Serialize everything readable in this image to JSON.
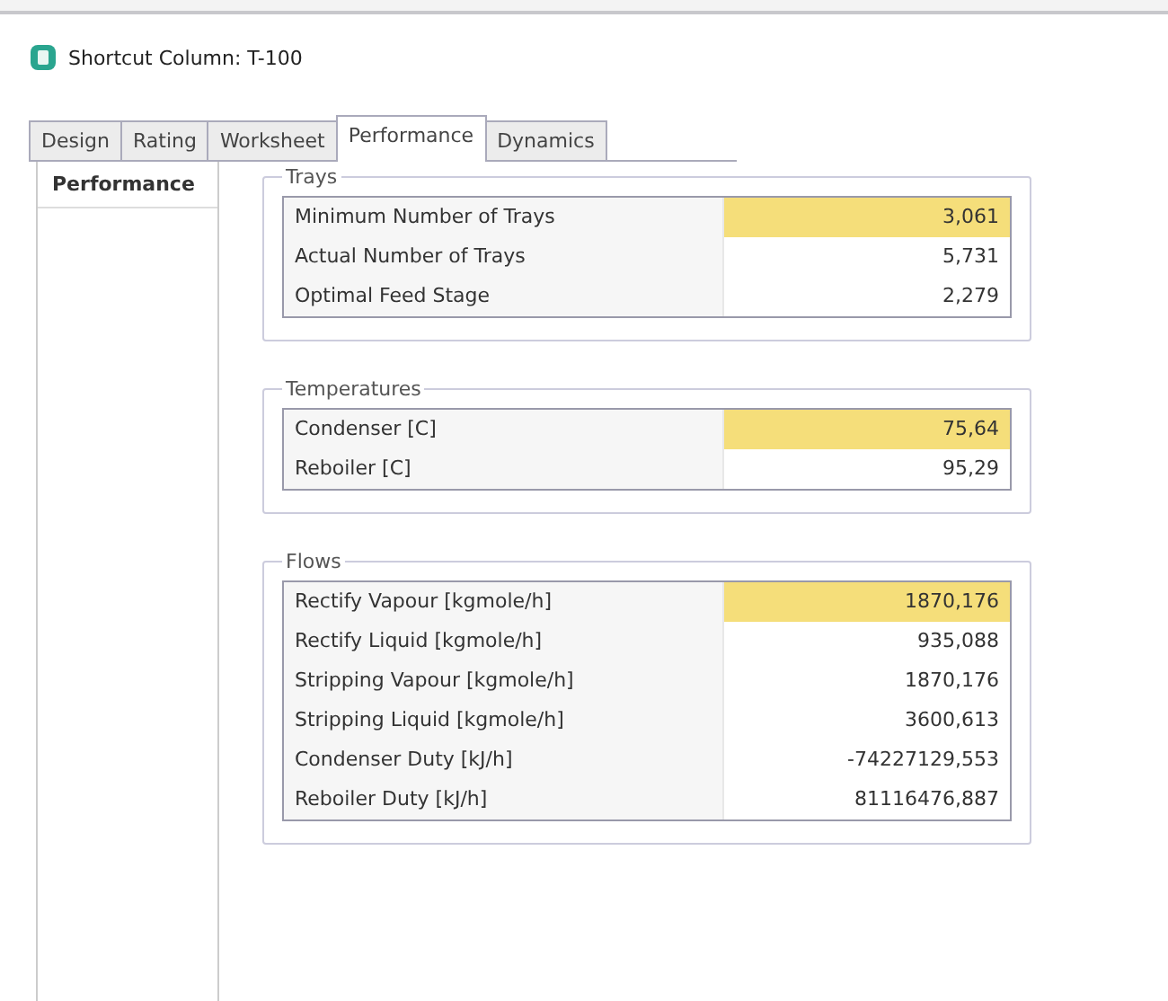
{
  "window": {
    "title": "Shortcut Column: T-100"
  },
  "tabs": [
    {
      "label": "Design",
      "selected": false
    },
    {
      "label": "Rating",
      "selected": false
    },
    {
      "label": "Worksheet",
      "selected": false
    },
    {
      "label": "Performance",
      "selected": true
    },
    {
      "label": "Dynamics",
      "selected": false
    }
  ],
  "sidebar": {
    "items": [
      {
        "label": "Performance",
        "selected": true
      }
    ]
  },
  "groups": [
    {
      "title": "Trays",
      "rows": [
        {
          "label": "Minimum Number of Trays",
          "value": "3,061",
          "highlighted": true
        },
        {
          "label": "Actual Number of Trays",
          "value": "5,731",
          "highlighted": false
        },
        {
          "label": "Optimal Feed Stage",
          "value": "2,279",
          "highlighted": false
        }
      ]
    },
    {
      "title": "Temperatures",
      "rows": [
        {
          "label": "Condenser [C]",
          "value": "75,64",
          "highlighted": true
        },
        {
          "label": "Reboiler [C]",
          "value": "95,29",
          "highlighted": false
        }
      ]
    },
    {
      "title": "Flows",
      "rows": [
        {
          "label": "Rectify Vapour [kgmole/h]",
          "value": "1870,176",
          "highlighted": true
        },
        {
          "label": "Rectify Liquid [kgmole/h]",
          "value": "935,088",
          "highlighted": false
        },
        {
          "label": "Stripping Vapour [kgmole/h]",
          "value": "1870,176",
          "highlighted": false
        },
        {
          "label": "Stripping Liquid [kgmole/h]",
          "value": "3600,613",
          "highlighted": false
        },
        {
          "label": "Condenser Duty [kJ/h]",
          "value": "-74227129,553",
          "highlighted": false
        },
        {
          "label": "Reboiler Duty [kJ/h]",
          "value": "81116476,887",
          "highlighted": false
        }
      ]
    }
  ]
}
